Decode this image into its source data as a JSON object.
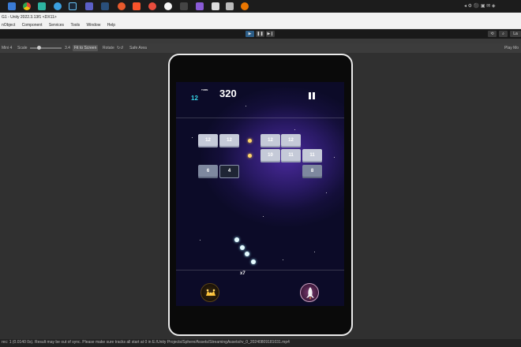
{
  "window": {
    "title": "G1 - Unity 2022.3.13f1 <DX11>"
  },
  "menu": {
    "items": [
      "nObject",
      "Component",
      "Services",
      "Tools",
      "Window",
      "Help"
    ]
  },
  "game_toolbar": {
    "display": "Mini 4",
    "scale_label": "Scale",
    "scale_value": "3.4",
    "fit_label": "Fit to Screen",
    "rotate_label": "Rotate",
    "safe_area_label": "Safe Area",
    "play_mode_label": "Play Mo"
  },
  "game": {
    "turn_label": "TURN",
    "turn_value": "12",
    "score": "320",
    "multiplier": "x7",
    "bricks": [
      "12",
      "12",
      "12",
      "12",
      "10",
      "11",
      "11",
      "6",
      "4",
      "8"
    ]
  },
  "status": {
    "message": "rec: 1 (0.0140 0s). Result may be out of sync. Please make sure tracks all start at 0 in E:/Unity Projects/Sphere/Assets/StreamingAssets/rv_0_20240809181031.mp4"
  },
  "colors": {
    "accent_cyan": "#36d6e7",
    "unity_play_blue": "#2c5d87",
    "bonus_gold": "#ffd66b"
  },
  "icons": {
    "taskbar": [
      "explorer-icon",
      "chrome-icon",
      "app-icon",
      "edge-icon",
      "steam-icon",
      "app-icon-2",
      "app-icon-3",
      "app-icon-4",
      "brave-icon",
      "app-icon-5",
      "yandex-icon",
      "app-icon-6",
      "visual-studio-icon",
      "unity-icon",
      "unity-icon-2",
      "blender-icon"
    ]
  }
}
